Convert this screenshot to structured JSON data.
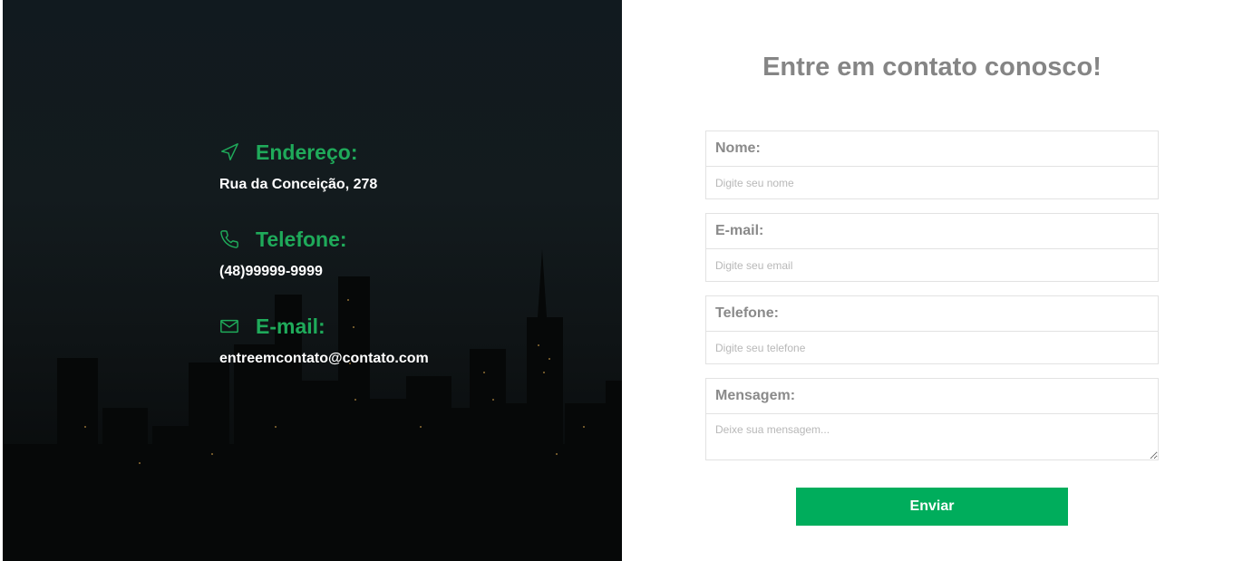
{
  "colors": {
    "accent": "#00ad5c",
    "title_gray": "#858585",
    "panel_dark": "#131b1e"
  },
  "contact": {
    "address": {
      "icon": "navigation-arrow-icon",
      "title": "Endereço:",
      "value": "Rua da Conceição, 278"
    },
    "phone": {
      "icon": "phone-icon",
      "title": "Telefone:",
      "value": "(48)99999-9999"
    },
    "email": {
      "icon": "envelope-icon",
      "title": "E-mail:",
      "value": "entreemcontato@contato.com"
    }
  },
  "form": {
    "title": "Entre em contato conosco!",
    "name": {
      "label": "Nome:",
      "placeholder": "Digite seu nome",
      "value": ""
    },
    "email": {
      "label": "E-mail:",
      "placeholder": "Digite seu email",
      "value": ""
    },
    "phone": {
      "label": "Telefone:",
      "placeholder": "Digite seu telefone",
      "value": ""
    },
    "message": {
      "label": "Mensagem:",
      "placeholder": "Deixe sua mensagem...",
      "value": ""
    },
    "submit_label": "Enviar"
  }
}
